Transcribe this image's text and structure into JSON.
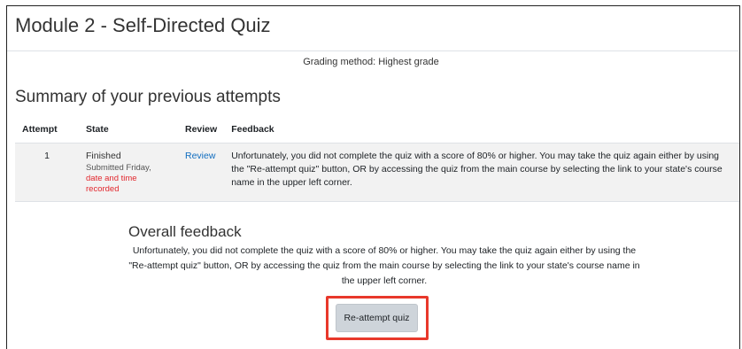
{
  "page": {
    "title": "Module 2 - Self-Directed Quiz",
    "grading_method": "Grading method: Highest grade"
  },
  "summary": {
    "heading": "Summary of your previous attempts",
    "columns": [
      "Attempt",
      "State",
      "Review",
      "Feedback"
    ],
    "rows": [
      {
        "attempt": "1",
        "state": "Finished",
        "submitted": "Submitted Friday,",
        "submitted_detail": "date and time recorded",
        "review": "Review",
        "feedback": "Unfortunately, you did not complete the quiz with a score of 80% or higher. You may take the quiz again either by using the \"Re-attempt quiz\" button, OR by accessing the quiz from the main course by selecting the link to your state's course name in the upper left corner."
      }
    ]
  },
  "overall_feedback": {
    "heading": "Overall feedback",
    "text": "Unfortunately, you did not complete the quiz with a score of 80% or higher. You may take the quiz again either by using the \"Re-attempt quiz\" button, OR by accessing the quiz from the main course by selecting the link to your state's course name in the upper left corner."
  },
  "actions": {
    "reattempt_label": "Re-attempt quiz"
  },
  "colors": {
    "highlight": "#e8382b",
    "link": "#0f6cbf",
    "submitted_detail": "#e2272d"
  }
}
